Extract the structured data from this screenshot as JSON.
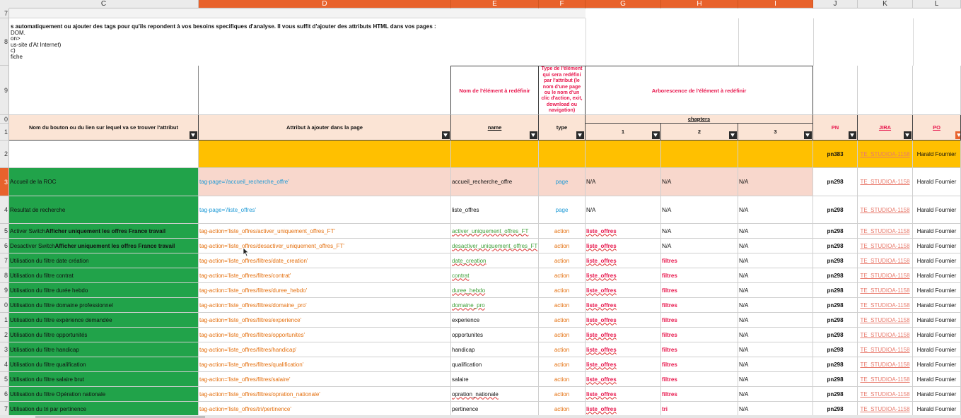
{
  "columns": [
    "C",
    "D",
    "E",
    "F",
    "G",
    "H",
    "I",
    "J",
    "K",
    "L"
  ],
  "row_numbers": {
    "r7": "7",
    "r8": "8",
    "r9": "9",
    "r10": "0",
    "r11": "1",
    "r12": "2",
    "data": [
      "3",
      "4",
      "5",
      "6",
      "7",
      "8",
      "9",
      "0",
      "1",
      "2",
      "3",
      "4",
      "5",
      "6",
      "7"
    ]
  },
  "intro": {
    "line1": "s automatiquement ou ajouter  des tags pour qu'ils repondent à vos besoins specifiques d'analyse. Il vous suffit d'ajouter des attributs HTML dans vos pages :",
    "line2": "DOM.",
    "line3": "on>",
    "line4": "us-site d'At Internet)",
    "line5": "c)",
    "line6": "fiche"
  },
  "header9": {
    "name_elem": "Nom de l'élément à redéfinir",
    "type_elem": "Type de l'élément qui sera redéfini par l'attribut (le nom d'une page ou le nom d'un clic d'action, exit, download ou navigation)",
    "arbo": "Arborescence de l'élément à redéfinir"
  },
  "header10": {
    "col_c": "Nom du bouton ou du lien sur lequel va se trouver l'attribut",
    "col_d": "Attribut à ajouter dans la page",
    "col_e": "name",
    "col_f": "type",
    "chapters": "chapters",
    "ch1": "1",
    "ch2": "2",
    "ch3": "3",
    "pn": "PN",
    "jira": "JIRA",
    "po": "PO"
  },
  "row12": {
    "pn": "pn383",
    "jira": "TE_STUDIOA-1158",
    "po": "Harald Fournier"
  },
  "rows": [
    {
      "c": "Accueil de la ROC",
      "c_bold": "",
      "d": "tag-page='/accueil_recherche_offre'",
      "e": "accueil_recherche_offre",
      "f": "page",
      "g": "N/A",
      "h": "N/A",
      "i": "N/A",
      "pn": "pn298",
      "jira": "TE_STUDIOA-1158",
      "po": "Harald Fournier"
    },
    {
      "c": "Resultat de recherche",
      "c_bold": "",
      "d": "tag-page='/liste_offres'",
      "e": "liste_offres",
      "f": "page",
      "g": "N/A",
      "h": "N/A",
      "i": "N/A",
      "pn": "pn298",
      "jira": "TE_STUDIOA-1158",
      "po": "Harald Fournier"
    },
    {
      "c": "Activer Switch ",
      "c_bold": "Afficher uniquement les offres France travail",
      "d": "tag-action='liste_offres/activer_uniquement_offres_FT'",
      "e": "activer_uniquement_offres_FT",
      "f": "action",
      "g": "liste_offres",
      "h": "N/A",
      "i": "N/A",
      "pn": "pn298",
      "jira": "TE_STUDIOA-1158",
      "po": "Harald Fournier"
    },
    {
      "c": "Desactiver Switch ",
      "c_bold": "Afficher uniquement les offres France travail",
      "d": "tag-action='liste_offres/desactiver_uniquement_offres_FT'",
      "e": "desactiver_uniquement_offres_FT",
      "f": "action",
      "g": "liste_offres",
      "h": "N/A",
      "i": "N/A",
      "pn": "pn298",
      "jira": "TE_STUDIOA-1158",
      "po": "Harald Fournier"
    },
    {
      "c": "Utilisation du filtre date création",
      "c_bold": "",
      "d": "tag-action='liste_offres/filtres/date_creation'",
      "e": "date_creation",
      "f": "action",
      "g": "liste_offres",
      "h": "filtres",
      "i": "N/A",
      "pn": "pn298",
      "jira": "TE_STUDIOA-1158",
      "po": "Harald Fournier"
    },
    {
      "c": "Utilisation du filtre contrat",
      "c_bold": "",
      "d": "tag-action='liste_offres/filtres/contrat'",
      "e": "contrat",
      "f": "action",
      "g": "liste_offres",
      "h": "filtres",
      "i": "N/A",
      "pn": "pn298",
      "jira": "TE_STUDIOA-1158",
      "po": "Harald Fournier"
    },
    {
      "c": "Utilisation du filtre durée hebdo",
      "c_bold": "",
      "d": "tag-action='liste_offres/filtres/duree_hebdo'",
      "e": "duree_hebdo",
      "f": "action",
      "g": "liste_offres",
      "h": "filtres",
      "i": "N/A",
      "pn": "pn298",
      "jira": "TE_STUDIOA-1158",
      "po": "Harald Fournier"
    },
    {
      "c": "Utilisation du filtre domaine professionnel",
      "c_bold": "",
      "d": "tag-action='liste_offres/filtres/domaine_pro'",
      "e": "domaine_pro",
      "f": "action",
      "g": "liste_offres",
      "h": "filtres",
      "i": "N/A",
      "pn": "pn298",
      "jira": "TE_STUDIOA-1158",
      "po": "Harald Fournier"
    },
    {
      "c": "Utilisation du filtre expérience demandée",
      "c_bold": "",
      "d": "tag-action='liste_offres/filtres/experience'",
      "e": "experience",
      "f": "action",
      "g": "liste_offres",
      "h": "filtres",
      "i": "N/A",
      "pn": "pn298",
      "jira": "TE_STUDIOA-1158",
      "po": "Harald Fournier"
    },
    {
      "c": "Utilisation du filtre opportunités",
      "c_bold": "",
      "d": "tag-action='liste_offres/filtres/opportunites'",
      "e": "opportunites",
      "f": "action",
      "g": "liste_offres",
      "h": "filtres",
      "i": "N/A",
      "pn": "pn298",
      "jira": "TE_STUDIOA-1158",
      "po": "Harald Fournier"
    },
    {
      "c": "Utilisation du filtre handicap",
      "c_bold": "",
      "d": "tag-action='liste_offres/filtres/handicap'",
      "e": "handicap",
      "f": "action",
      "g": "liste_offres",
      "h": "filtres",
      "i": "N/A",
      "pn": "pn298",
      "jira": "TE_STUDIOA-1158",
      "po": "Harald Fournier"
    },
    {
      "c": "Utilisation du filtre qualification",
      "c_bold": "",
      "d": "tag-action='liste_offres/filtres/qualification'",
      "e": "qualification",
      "f": "action",
      "g": "liste_offres",
      "h": "filtres",
      "i": "N/A",
      "pn": "pn298",
      "jira": "TE_STUDIOA-1158",
      "po": "Harald Fournier"
    },
    {
      "c": "Utilisation du filtre salaire brut",
      "c_bold": "",
      "d": "tag-action='liste_offres/filtres/salaire'",
      "e": "salaire",
      "f": "action",
      "g": "liste_offres",
      "h": "filtres",
      "i": "N/A",
      "pn": "pn298",
      "jira": "TE_STUDIOA-1158",
      "po": "Harald Fournier"
    },
    {
      "c": "Utilisation du filtre Opération nationale",
      "c_bold": "",
      "d": "tag-action='liste_offres/filtres/opration_nationale'",
      "e": "opration_nationale",
      "f": "action",
      "g": "liste_offres",
      "h": "filtres",
      "i": "N/A",
      "pn": "pn298",
      "jira": "TE_STUDIOA-1158",
      "po": "Harald Fournier"
    },
    {
      "c": "Utilisation du tri par pertinence",
      "c_bold": "",
      "d": "tag-action='liste_offres/tri/pertinence'",
      "e": "pertinence",
      "f": "action",
      "g": "liste_offres",
      "h": "tri",
      "i": "N/A",
      "pn": "pn298",
      "jira": "TE_STUDIOA-1158",
      "po": "Harald Fournier"
    }
  ]
}
